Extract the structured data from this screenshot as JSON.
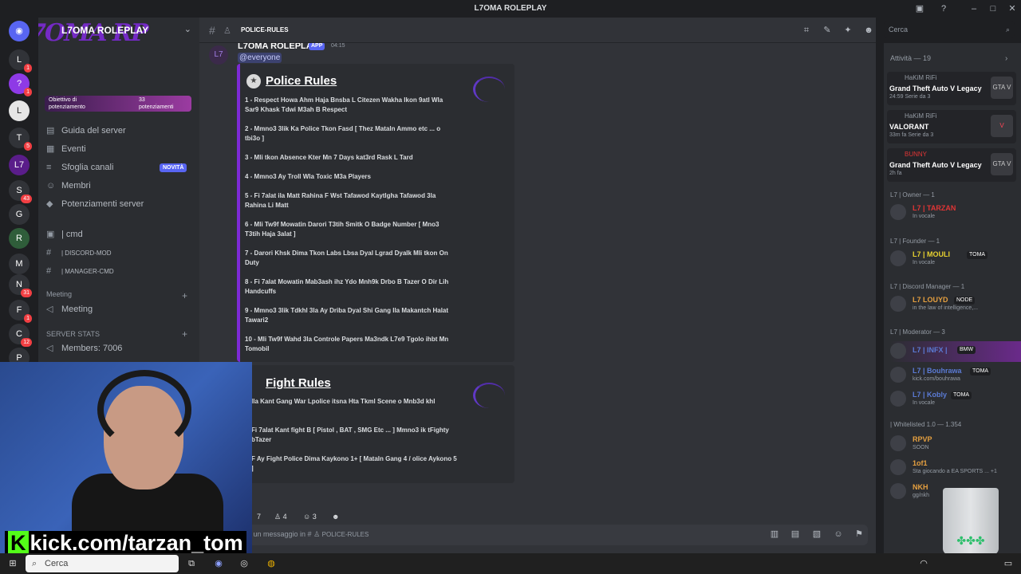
{
  "window": {
    "title": "L7OMA ROLEPLAY"
  },
  "server": {
    "name": "L7OMA ROLEPLAY",
    "logo": "L7OMA RP"
  },
  "boost": {
    "goal": "Obiettivo di potenziamento",
    "count": "33",
    "count_label": "potenziamenti"
  },
  "nav": [
    {
      "label": "Guida del server",
      "icon": "guide-icon"
    },
    {
      "label": "Eventi",
      "icon": "calendar-icon"
    },
    {
      "label": "Sfoglia canali",
      "icon": "browse-icon",
      "tag": "NOVITÀ"
    },
    {
      "label": "Membri",
      "icon": "members-icon"
    },
    {
      "label": "Potenziamenti server",
      "icon": "boost-icon"
    }
  ],
  "channels": [
    {
      "label": "| cmd"
    },
    {
      "label": "| DISCORD-MOD"
    },
    {
      "label": "| MANAGER-CMD"
    }
  ],
  "categories": {
    "meeting": "Meeting",
    "meeting_channel": "Meeting",
    "stats": "SERVER STATS",
    "members_stat": "Members: 7006"
  },
  "guild_badges": [
    "1",
    "1",
    "",
    "5",
    "",
    "43",
    "",
    "",
    "",
    "31",
    "1",
    "12",
    "50"
  ],
  "chat": {
    "channel": "POLICE-RULES",
    "composer_placeholder": "Invia un messaggio in #",
    "composer_channel": "POLICE-RULES"
  },
  "message": {
    "author": "L7OMA ROLEPLAY",
    "badge": "APP",
    "time": "04:15",
    "mention": "@everyone"
  },
  "police": {
    "title": "Police Rules",
    "rules": [
      "1 - Respect Howa Ahm Haja Bnsba L Citezen Wakha Ikon 9atl Wla Sar9 Khask Tdwi M3ah B Respect",
      "2 - Mmno3 3lik Ka Police Tkon Fasd [ Thez Mataln Ammo etc ... o tbi3o ]",
      "3 - Mli tkon Absence Kter Mn 7 Days kat3rd Rask L Tard",
      "4 - Mmno3 Ay Troll Wla Toxic M3a Players",
      "5 - Fi 7alat ila Matt Rahina F Wst Tafawod Kaytlgha Tafawod 3la Rahina Li Matt",
      "6 - Mli Tw9f Mowatin Darori T3tih Smitk O Badge Number [ Mno3 T3tih Haja 3alat ]",
      "7 - Darori Khsk Dima Tkon Labs Lbsa Dyal Lgrad Dyalk Mli tkon On Duty",
      "8 - Fi 7alat Mowatin Mab3ash ihz Ydo Mnh9k Drbo B Tazer O Dir Lih Handcuffs",
      "9 - Mmno3 3lik Tdkhl 3la Ay Driba Dyal Shi Gang Ila Makantch Halat Tawari2",
      "10 - Mli Tw9f Wahd 3la Controle Papers Ma3ndk L7e9 Tgolo ihbt Mn Tomobil"
    ]
  },
  "fight": {
    "title": "Fight Rules",
    "rules": [
      "Ila Kant Gang War Lpolice itsna Hta Tkml Scene o Mnb3d khl",
      "Fi 7alat Kant fight B [ Pistol , BAT , SMG Etc ... ] Mmno3 ik tFighty bTazer",
      "F Ay Fight Police Dima Kaykono 1+ [ Mataln Gang 4 / olice Aykono 5 ]"
    ]
  },
  "reactions": [
    {
      "count": "7"
    },
    {
      "count": "4"
    },
    {
      "count": "3"
    },
    {
      "count": ""
    }
  ],
  "search": {
    "placeholder": "Cerca"
  },
  "activity": {
    "header": "Attività — 19",
    "cards": [
      {
        "user": "HaKiM RiFi",
        "game": "Grand Theft Auto V Legacy",
        "meta": "24:59  Serie da 3",
        "icon": "GTA V"
      },
      {
        "user": "HaKiM RiFi",
        "game": "VALORANT",
        "meta": "33m fa  Serie da 3",
        "icon": "V"
      },
      {
        "user": "BUNNY",
        "game": "Grand Theft Auto V Legacy",
        "meta": "2h fa",
        "icon": "GTA V"
      }
    ]
  },
  "roles": [
    {
      "label": "L7 | Owner — 1",
      "members": [
        {
          "name": "L7 | TARZAN",
          "status": "In vocale",
          "color": "#e03535"
        }
      ]
    },
    {
      "label": "L7 | Founder — 1",
      "members": [
        {
          "name": "L7 | MOULI",
          "status": "In vocale",
          "color": "#e6d030",
          "tag": "TOMA"
        }
      ]
    },
    {
      "label": "L7 | Discord Manager — 1",
      "members": [
        {
          "name": "L7 LOUYD",
          "status": "in the law of intelligence,...",
          "color": "#e6a040",
          "tag": "NODE"
        }
      ]
    },
    {
      "label": "L7 | Moderator — 3",
      "members": [
        {
          "name": "L7 | INFX |",
          "status": "",
          "color": "#5b7bd5",
          "tag": "BMW"
        },
        {
          "name": "L7 | Bouhrawa",
          "status": "kick.com/bouhrawa",
          "color": "#5b7bd5",
          "tag": "TOMA"
        },
        {
          "name": "L7 | Kobly",
          "status": "In vocale",
          "color": "#5b7bd5",
          "tag": "TOMA"
        }
      ]
    },
    {
      "label": "| Whitelisted 1.0 — 1.354",
      "members": [
        {
          "name": "RPVP",
          "status": "SOON",
          "color": "#dbdee1"
        },
        {
          "name": "1of1",
          "status": "Sta giocando a EA SPORTS ... +1",
          "color": "#dbdee1"
        },
        {
          "name": "NKH",
          "status": "gg/nkh",
          "color": "#dbdee1"
        }
      ]
    }
  ],
  "overlay": {
    "kick": "kick.com/tarzan_tom",
    "k": "K"
  },
  "taskbar": {
    "search": "Cerca"
  }
}
